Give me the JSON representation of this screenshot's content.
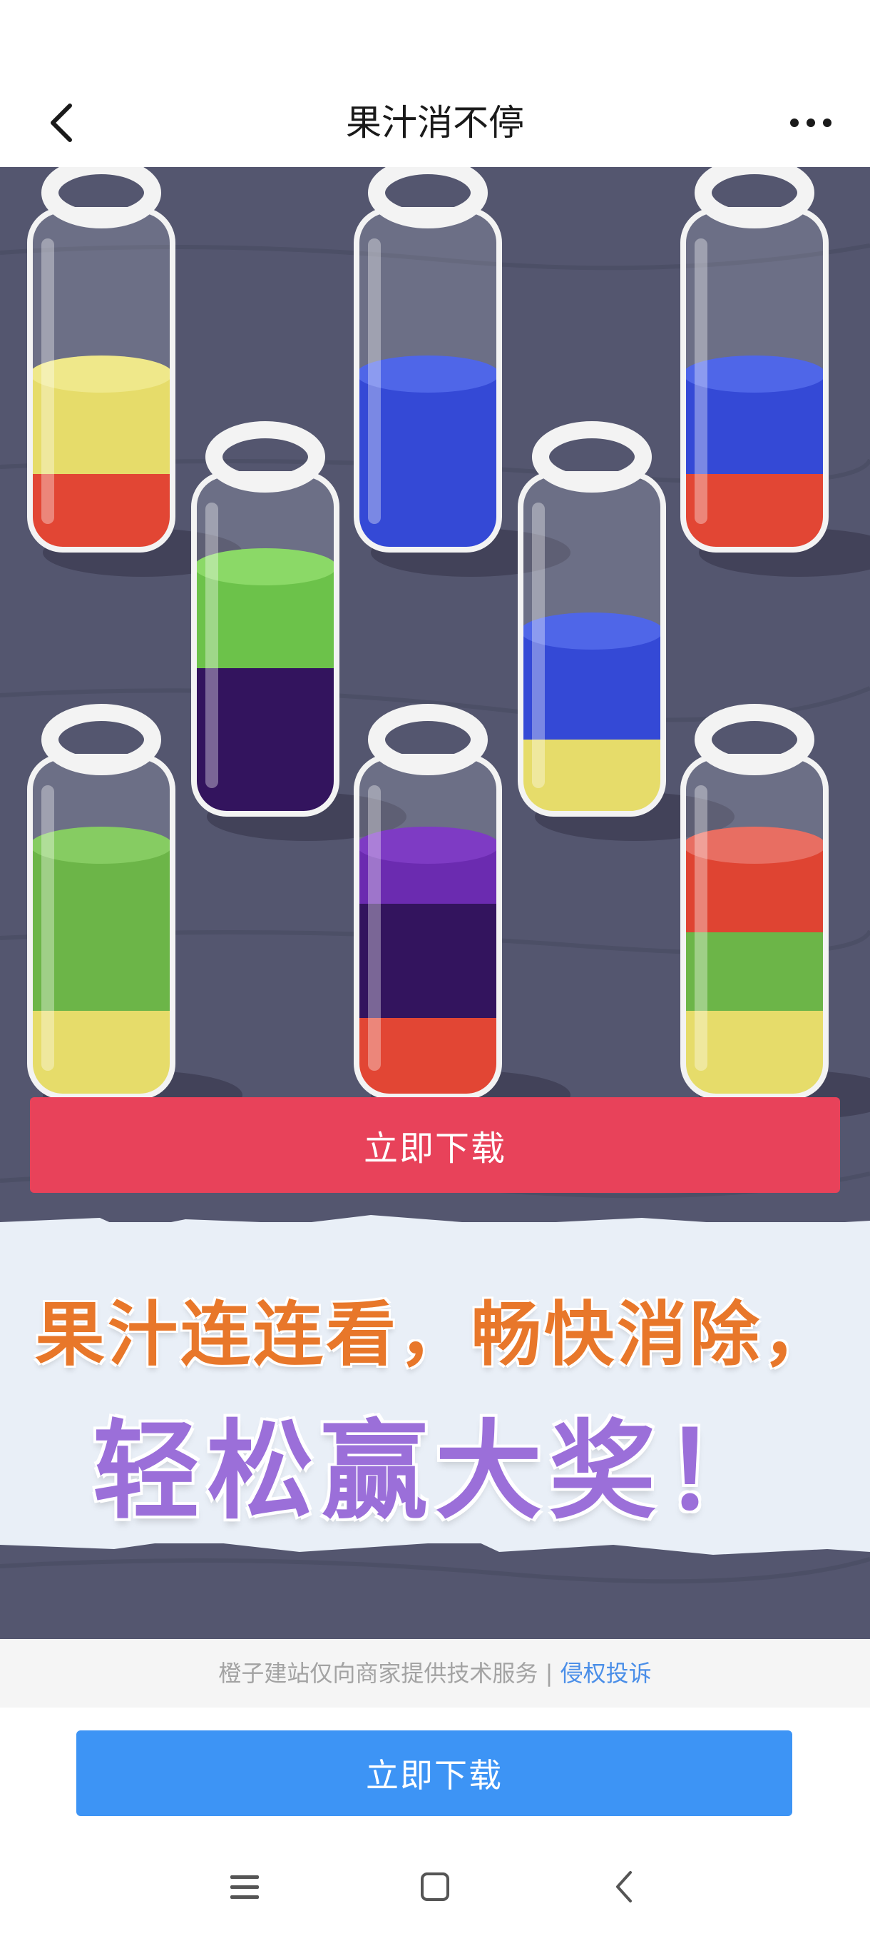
{
  "nav": {
    "title": "果汁消不停",
    "back_icon": "chevron-left-icon",
    "more_icon": "more-dots-icon"
  },
  "banner": {
    "background_color": "#54566f",
    "cta_label": "立即下载",
    "cta_color": "#e8425a",
    "slogan_line1": "果汁连连看，畅快消除，",
    "slogan_line2": "轻松赢大奖！",
    "slogan_line1_color": "#e8772a",
    "slogan_line2_color": "#9b6fd9",
    "bottles": [
      {
        "layers_bottom_to_top": [
          "red",
          "yellow"
        ]
      },
      {
        "layers_bottom_to_top": [
          "blue"
        ]
      },
      {
        "layers_bottom_to_top": [
          "red",
          "blue"
        ]
      },
      {
        "layers_bottom_to_top": [
          "dark-purple",
          "green"
        ]
      },
      {
        "layers_bottom_to_top": [
          "yellow",
          "blue"
        ]
      },
      {
        "layers_bottom_to_top": [
          "yellow",
          "green"
        ]
      },
      {
        "layers_bottom_to_top": [
          "red",
          "dark-purple",
          "purple"
        ]
      },
      {
        "layers_bottom_to_top": [
          "yellow",
          "green",
          "red"
        ]
      }
    ]
  },
  "footer": {
    "service_text": "橙子建站仅向商家提供技术服务 | ",
    "report_link": "侵权投诉"
  },
  "bottom_cta": {
    "label": "立即下载",
    "color": "#3d94f5"
  },
  "system_nav": {
    "menu_icon": "menu-icon",
    "home_icon": "home-square-icon",
    "back_icon": "back-arrow-icon"
  }
}
